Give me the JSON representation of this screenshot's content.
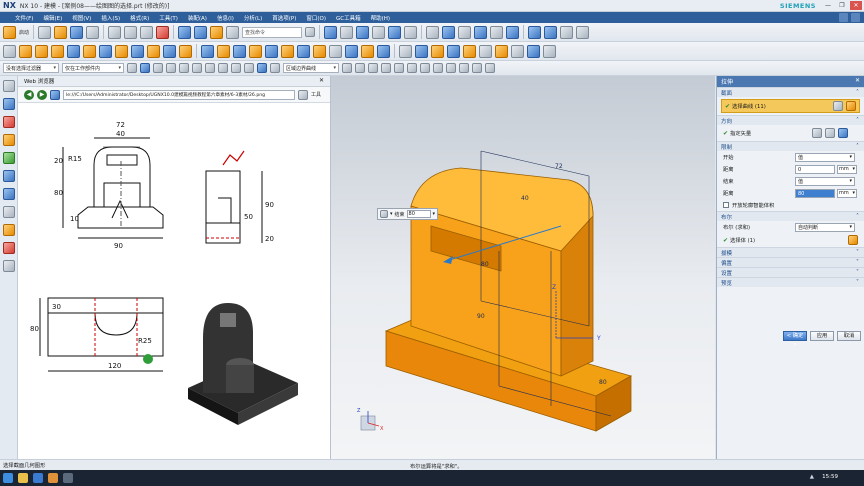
{
  "app": {
    "logo": "NX",
    "window_title": "NX 10 - 建模 - [案例08——绘图图的选择.prt  (修改的)]",
    "vendor": "SIEMENS",
    "win_controls": [
      "—",
      "❐",
      "✕"
    ]
  },
  "menu": {
    "items": [
      "文件(F)",
      "编辑(E)",
      "视图(V)",
      "插入(S)",
      "格式(R)",
      "工具(T)",
      "装配(A)",
      "信息(I)",
      "分析(L)",
      "首选项(P)",
      "窗口(O)",
      "GC工具箱",
      "帮助(H)"
    ]
  },
  "toolbar1": {
    "start_label": "启动",
    "search_placeholder": "查找命令"
  },
  "toolbar3": {
    "selection_filter": "没有选择过滤器",
    "scope": "仅在工作部件内",
    "rule": "区域边界曲线"
  },
  "web_browser": {
    "title": "Web 浏览器",
    "address": "le:///C:/Users/Administrator/Desktop/UGNX10.0建模篇视频教程第六章素材/6-3素材/26.png",
    "tools_label": "工具",
    "drawing": {
      "front_dims": [
        "R15",
        "40",
        "72",
        "20",
        "80",
        "10",
        "90"
      ],
      "side_dims": [
        "90",
        "50",
        "20"
      ],
      "top_dims": [
        "30",
        "80",
        "R25",
        "120"
      ]
    }
  },
  "viewport": {
    "input_label": "结束",
    "input_value": "80",
    "axis_labels": [
      "Y",
      "Z",
      "X"
    ],
    "model_dims": [
      "72",
      "40",
      "80",
      "90",
      "80"
    ]
  },
  "dialog": {
    "title": "拉伸",
    "sections": {
      "section": {
        "title": "截面",
        "select_curve": "选择曲线 (11)"
      },
      "direction": {
        "title": "方向",
        "specify_vector": "指定矢量"
      },
      "limits": {
        "title": "限制",
        "start_label": "开始",
        "start_value": "值",
        "start_distance_label": "距离",
        "start_distance": "0",
        "end_label": "结束",
        "end_value": "值",
        "end_distance_label": "距离",
        "end_distance": "80",
        "unit": "mm",
        "open_profile": "开放轮廓智能体积"
      },
      "boolean": {
        "title": "布尔",
        "boolean_label": "布尔 (求和)",
        "boolean_value": "自动判断",
        "select_body": "选择体 (1)"
      },
      "collapsed": [
        "拔模",
        "偏置",
        "设置",
        "预览"
      ]
    },
    "buttons": {
      "ok": "< 确定 >",
      "apply": "应用",
      "cancel": "取消"
    }
  },
  "statusbar": {
    "left": "选择截面几何图形",
    "middle": "布尔运算将是\"求和\"。"
  },
  "taskbar": {
    "clock": "15:59"
  }
}
